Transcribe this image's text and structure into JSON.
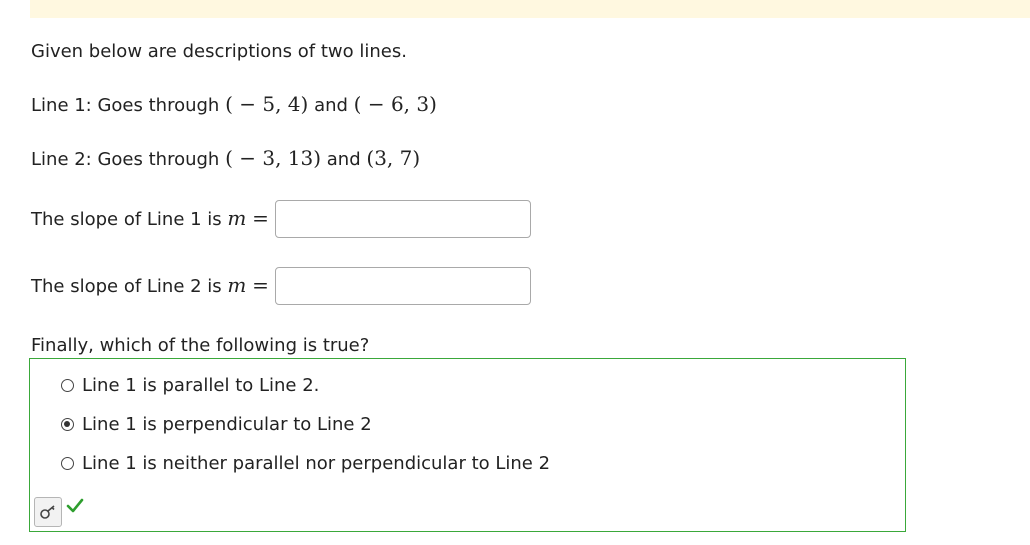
{
  "intro": "Given below are descriptions of two lines.",
  "line1": {
    "label": "Line 1: Goes through",
    "point_a": "( − 5, 4)",
    "joiner": "and",
    "point_b": "( − 6, 3)"
  },
  "line2": {
    "label": "Line 2: Goes through",
    "point_a": "( − 3, 13)",
    "joiner": "and",
    "point_b": "(3, 7)"
  },
  "slope1": {
    "label": "The slope of Line 1 is",
    "var": "m",
    "equals": "=",
    "value": ""
  },
  "slope2": {
    "label": "The slope of Line 2 is",
    "var": "m",
    "equals": "=",
    "value": ""
  },
  "question": "Finally, which of the following is true?",
  "options": [
    {
      "label": "Line 1 is parallel to Line 2.",
      "selected": false
    },
    {
      "label": "Line 1 is perpendicular to Line 2",
      "selected": true
    },
    {
      "label": "Line 1 is neither parallel nor perpendicular to Line 2",
      "selected": false
    }
  ],
  "status": {
    "icon": "check-icon",
    "color": "#2e9e2e"
  },
  "colors": {
    "banner": "#fff8e0",
    "correct_border": "#3aa83a"
  },
  "icons": {
    "key_button": "key-icon"
  }
}
